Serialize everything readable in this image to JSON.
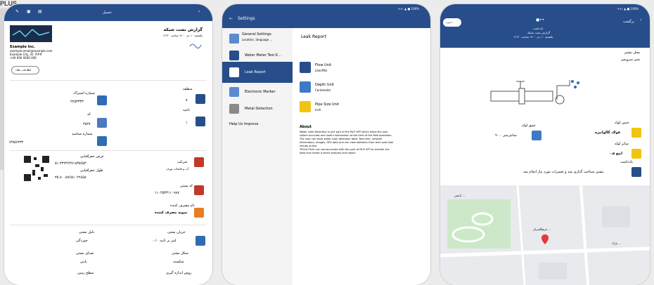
{
  "brand": "PLUS",
  "phone1": {
    "header_title": "تحمیل",
    "report_title": "گزارش نشت شبکه",
    "report_date": "یکشنبه ۱۰ دی ۱۴۰۰ ساعت ۱۲:۳۰",
    "company_name": "Example Inc.",
    "company_lines": [
      "example.email@example.com",
      "Example City, St. ###",
      "+00 000 0000 000"
    ],
    "owner_button": "اطلاعات ملک",
    "region_label": "منطقه",
    "region_value": "۸",
    "zone_label": "ناحیه",
    "zone_value": "۱",
    "subscription_label": "شماره اشتراک",
    "subscription_value": "۲۲۵۳۳۳۳",
    "code_label": "کد",
    "code_value": "۴۵۲۷",
    "id_label": "شماره شناسه",
    "id_value": "۱۳۷۵۶۳۳۲",
    "address_label": "عرض جغرافیایی",
    "address_value": "۵۱.۳۳۲۳۶۴۷۱۸۳۵۶۵۳",
    "lng_label": "طول جغرافیایی",
    "lng_value": "۳۵.۷۰۰۵۹۶۵۱۰۲۹۶۵۸",
    "company_label": "شرکت",
    "company_value": "آب و فاضلاب تهران",
    "postal_label": "کد پستی",
    "postal_value": "۱۱۰۴۵۳۳۱۱۰۹۸۷",
    "consumer_label": "نام مصرف کننده",
    "consumer_value": "نمونه مصرف کننده",
    "leak_label": "دلیل نشتی",
    "leak_value": "خوردگی",
    "flow_label": "جریان نشتی",
    "flow_value": "۰.۱۰ لیتر بر ثانیه",
    "sound_label": "صدای نشتی",
    "sound_value": "پایین",
    "shape_label": "شکل نشتی",
    "shape_value": "شکسته",
    "ground_label": "سطح زمین",
    "method_label": "روش اندازه گیری"
  },
  "phone2": {
    "status": "۹:۴۱ ▲ ■ 100%",
    "title": "Settings",
    "menu": [
      {
        "title": "General Settings",
        "sub": "Location, language ..."
      },
      {
        "title": "Water Meter Test K..."
      },
      {
        "title": "Leak Report"
      },
      {
        "title": "Electronic Marker"
      },
      {
        "title": "Metal Detection"
      },
      {
        "title": "Help Us Improve"
      }
    ],
    "right_title": "Leak Report",
    "items": [
      {
        "title": "Flow Unit",
        "sub": "Liter/Min"
      },
      {
        "title": "Depth Unit",
        "sub": "Centimeter"
      },
      {
        "title": "Pipe Size Unit",
        "sub": "Inch"
      }
    ],
    "about_title": "About",
    "about_text": [
      "Water Leak Detection is one part of the PA.P eFP which helps the user",
      "collect accurate and useful information at the time of the field operation.",
      "The user can store water Leak detection data: Test time, network",
      "information, images, GPS data and can view statistics from their past leak",
      "results online.",
      "TESLA PLUS can communicate with this part of PA.P eFP to transfer the",
      "data and create a smart analysis and report."
    ]
  },
  "phone3": {
    "status": "۹:۴۱ ▲ ■ 100%",
    "save_label": "ذخیره",
    "back_label": "برگشت",
    "heading": "یادداشت",
    "subheading": "گزارش نشت شبکه",
    "date": "یکشنبه ۱۰ دی ۱۴۰۰ ساعت ۱۲:۳۰",
    "place_label": "محل نشتی",
    "place_value": "شیر سرویس",
    "pipe_type_label": "جنس لوله",
    "pipe_type_value": "فولاد گالوانیزه",
    "depth_label": "عمق لوله",
    "depth_value": "۹۰.۰ سانتی‌متر",
    "size_label": "سایز لوله",
    "size_value": "۰.۵ اینچ",
    "note_label": "یادداشت",
    "note_value": "نشتی شناخت گذاری شد و تعمیرات مورد نیاز انجام شد.",
    "map_labels": [
      "فرهنگسرای ...",
      "آژانس ...",
      "پارک ..."
    ]
  },
  "colors": {
    "primary": "#274e8b",
    "accent": "#e25a2b",
    "map": "#e8eaed"
  }
}
